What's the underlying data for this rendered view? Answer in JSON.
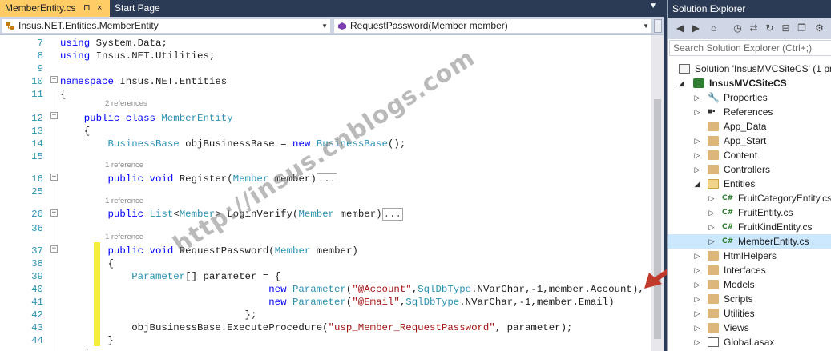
{
  "editor": {
    "tabs": [
      {
        "label": "MemberEntity.cs",
        "pin": "⊓",
        "close": "×",
        "active": true
      },
      {
        "label": "Start Page",
        "active": false
      }
    ],
    "nav_left": "Insus.NET.Entities.MemberEntity",
    "nav_right": "RequestPassword(Member member)",
    "overflow_glyph": "▼",
    "lines": [
      {
        "n": "7",
        "code": [
          [
            "kw",
            "using"
          ],
          [
            "",
            " System.Data;"
          ]
        ]
      },
      {
        "n": "8",
        "code": [
          [
            "kw",
            "using"
          ],
          [
            "",
            " Insus.NET.Utilities;"
          ]
        ]
      },
      {
        "n": "9",
        "code": []
      },
      {
        "n": "10",
        "code": [
          [
            "kw",
            "namespace"
          ],
          [
            "",
            " Insus.NET.Entities"
          ]
        ]
      },
      {
        "n": "11",
        "code": [
          [
            "",
            "{"
          ]
        ]
      },
      {
        "n": "12",
        "code": [
          [
            "",
            "    "
          ],
          [
            "kw",
            "public class"
          ],
          [
            "",
            " "
          ],
          [
            "ty",
            "MemberEntity"
          ]
        ]
      },
      {
        "n": "13",
        "code": [
          [
            "",
            "    {"
          ]
        ]
      },
      {
        "n": "14",
        "code": [
          [
            "",
            "        "
          ],
          [
            "ty",
            "BusinessBase"
          ],
          [
            "",
            " objBusinessBase = "
          ],
          [
            "kw",
            "new"
          ],
          [
            "",
            " "
          ],
          [
            "ty",
            "BusinessBase"
          ],
          [
            "",
            "();"
          ]
        ]
      },
      {
        "n": "15",
        "code": []
      },
      {
        "n": "16",
        "code": [
          [
            "",
            "        "
          ],
          [
            "kw",
            "public void"
          ],
          [
            "",
            " Register("
          ],
          [
            "ty",
            "Member"
          ],
          [
            "",
            " member)"
          ],
          [
            "box",
            "..."
          ]
        ]
      },
      {
        "n": "25",
        "code": []
      },
      {
        "n": "26",
        "code": [
          [
            "",
            "        "
          ],
          [
            "kw",
            "public"
          ],
          [
            "",
            " "
          ],
          [
            "ty",
            "List"
          ],
          [
            "",
            "<"
          ],
          [
            "ty",
            "Member"
          ],
          [
            "",
            "> LoginVerify("
          ],
          [
            "ty",
            "Member"
          ],
          [
            "",
            " member)"
          ],
          [
            "box",
            "..."
          ]
        ]
      },
      {
        "n": "36",
        "code": []
      },
      {
        "n": "37",
        "code": [
          [
            "",
            "        "
          ],
          [
            "kw",
            "public void"
          ],
          [
            "",
            " RequestPassword("
          ],
          [
            "ty",
            "Member"
          ],
          [
            "",
            " member)"
          ]
        ]
      },
      {
        "n": "38",
        "code": [
          [
            "",
            "        {"
          ]
        ]
      },
      {
        "n": "39",
        "code": [
          [
            "",
            "            "
          ],
          [
            "ty",
            "Parameter"
          ],
          [
            "",
            "[] parameter = {"
          ]
        ]
      },
      {
        "n": "40",
        "code": [
          [
            "",
            "                                   "
          ],
          [
            "kw",
            "new"
          ],
          [
            "",
            " "
          ],
          [
            "ty",
            "Parameter"
          ],
          [
            "",
            "("
          ],
          [
            "str",
            "\"@Account\""
          ],
          [
            "",
            ","
          ],
          [
            "ty",
            "SqlDbType"
          ],
          [
            "",
            ".NVarChar,-1,member.Account),"
          ]
        ]
      },
      {
        "n": "41",
        "code": [
          [
            "",
            "                                   "
          ],
          [
            "kw",
            "new"
          ],
          [
            "",
            " "
          ],
          [
            "ty",
            "Parameter"
          ],
          [
            "",
            "("
          ],
          [
            "str",
            "\"@Email\""
          ],
          [
            "",
            ","
          ],
          [
            "ty",
            "SqlDbType"
          ],
          [
            "",
            ".NVarChar,-1,member.Email)"
          ]
        ]
      },
      {
        "n": "42",
        "code": [
          [
            "",
            "                               };"
          ]
        ]
      },
      {
        "n": "43",
        "code": [
          [
            "",
            "            objBusinessBase.ExecuteProcedure("
          ],
          [
            "str",
            "\"usp_Member_RequestPassword\""
          ],
          [
            "",
            ", parameter);"
          ]
        ]
      },
      {
        "n": "44",
        "code": [
          [
            "",
            "        }"
          ]
        ]
      },
      {
        "n": "",
        "code": [
          [
            "",
            "    }"
          ]
        ]
      }
    ],
    "references": {
      "class": "2 references",
      "register": "1 reference",
      "login": "1 reference",
      "request": "1 reference"
    },
    "watermark": "http://insus.cnblogs.com"
  },
  "solution_explorer": {
    "title": "Solution Explorer",
    "search_placeholder": "Search Solution Explorer (Ctrl+;)",
    "solution": "Solution 'InsusMVCSiteCS' (1 pro",
    "project": "InsusMVCSiteCS",
    "items": [
      {
        "label": "Properties",
        "icon": "wrench-icon"
      },
      {
        "label": "References",
        "icon": "references-icon"
      },
      {
        "label": "App_Data",
        "icon": "folder-icon"
      },
      {
        "label": "App_Start",
        "icon": "folder-icon"
      },
      {
        "label": "Content",
        "icon": "folder-icon"
      },
      {
        "label": "Controllers",
        "icon": "folder-icon"
      },
      {
        "label": "Entities",
        "icon": "folder-open-icon"
      }
    ],
    "entity_files": [
      {
        "label": "FruitCategoryEntity.cs"
      },
      {
        "label": "FruitEntity.cs"
      },
      {
        "label": "FruitKindEntity.cs"
      },
      {
        "label": "MemberEntity.cs",
        "selected": true
      }
    ],
    "more_items": [
      {
        "label": "HtmlHelpers"
      },
      {
        "label": "Interfaces"
      },
      {
        "label": "Models"
      },
      {
        "label": "Scripts"
      },
      {
        "label": "Utilities"
      },
      {
        "label": "Views"
      },
      {
        "label": "Global.asax"
      }
    ],
    "cs_badge": "C#"
  },
  "colors": {
    "active_tab": "#ffcc66",
    "chrome": "#2b3a55",
    "keyword": "#0000ff",
    "type": "#2b91af",
    "string": "#a31515",
    "change_marker": "#f5ef3a",
    "arrow": "#c0392b"
  }
}
